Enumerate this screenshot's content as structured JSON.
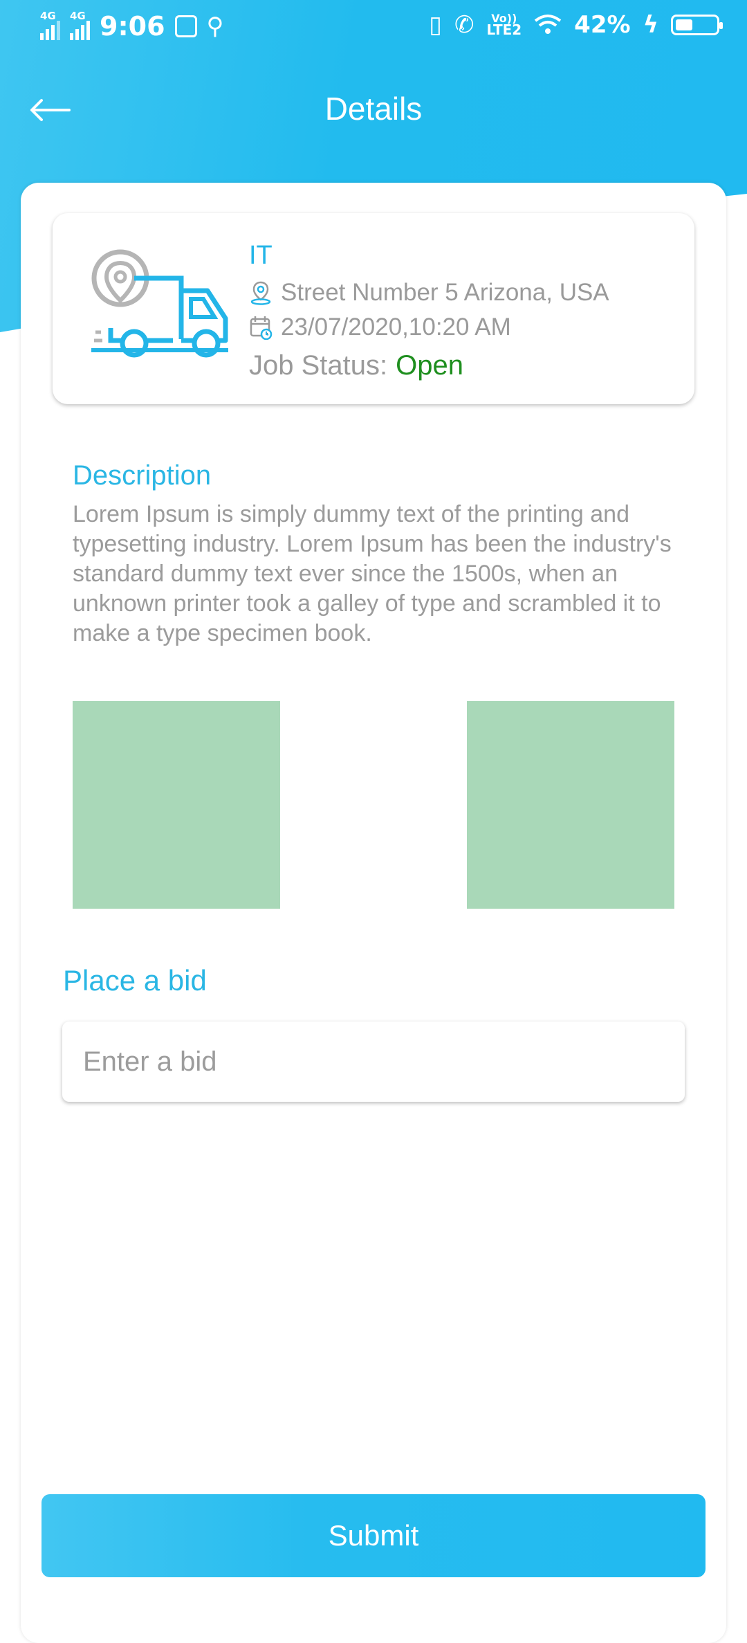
{
  "status_bar": {
    "network_1": "4G",
    "network_2": "4G",
    "time": "9:06",
    "volte": "Vo))",
    "lte": "LTE2",
    "battery_percent": "42%"
  },
  "header": {
    "title": "Details",
    "back_icon": "arrow-left-icon"
  },
  "job": {
    "category": "IT",
    "address": "Street Number 5 Arizona, USA",
    "datetime": "23/07/2020,10:20 AM",
    "status_label": "Job Status:",
    "status_value": "Open",
    "status_color": "#1f8f1f"
  },
  "description": {
    "heading": "Description",
    "text": "Lorem Ipsum is simply dummy text of the printing and typesetting industry. Lorem Ipsum has been the industry's standard dummy text ever since the 1500s, when an unknown printer took a galley of type and scrambled it to make a type specimen book."
  },
  "bid": {
    "heading": "Place a bid",
    "placeholder": "Enter a bid",
    "value": ""
  },
  "submit_label": "Submit",
  "colors": {
    "accent": "#22bbee",
    "image_placeholder": "#a9d8b8"
  }
}
